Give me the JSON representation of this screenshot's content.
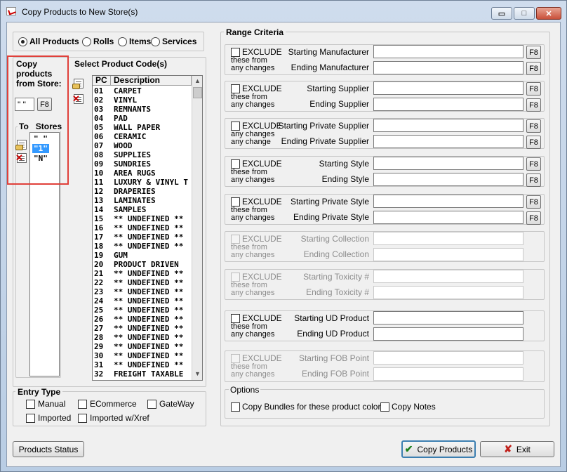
{
  "window": {
    "title": "Copy Products to New Store(s)",
    "controls": {
      "minimize": "▭",
      "maximize": "□",
      "close": "✕"
    }
  },
  "product_type": {
    "options": [
      "All Products",
      "Rolls",
      "Items",
      "Services"
    ],
    "selected": "All Products"
  },
  "copy_from": {
    "label": "Copy products from Store:",
    "value": "\" \"",
    "lookup_label": "F8"
  },
  "to_stores": {
    "label": "To   Stores",
    "items": [
      "\" \"",
      "\"1\"",
      "\"N\""
    ],
    "selected_index": 1
  },
  "product_codes": {
    "label": "Select Product Code(s)",
    "columns": [
      "PC",
      "Description"
    ],
    "rows": [
      [
        "01",
        "CARPET"
      ],
      [
        "02",
        "VINYL"
      ],
      [
        "03",
        "REMNANTS"
      ],
      [
        "04",
        "PAD"
      ],
      [
        "05",
        "WALL PAPER"
      ],
      [
        "06",
        "CERAMIC"
      ],
      [
        "07",
        "WOOD"
      ],
      [
        "08",
        "SUPPLIES"
      ],
      [
        "09",
        "SUNDRIES"
      ],
      [
        "10",
        "AREA RUGS"
      ],
      [
        "11",
        "LUXURY & VINYL T"
      ],
      [
        "12",
        "DRAPERIES"
      ],
      [
        "13",
        "LAMINATES"
      ],
      [
        "14",
        "SAMPLES"
      ],
      [
        "15",
        "** UNDEFINED **"
      ],
      [
        "16",
        "** UNDEFINED **"
      ],
      [
        "17",
        "** UNDEFINED **"
      ],
      [
        "18",
        "** UNDEFINED **"
      ],
      [
        "19",
        "GUM"
      ],
      [
        "20",
        "PRODUCT DRIVEN"
      ],
      [
        "21",
        "** UNDEFINED **"
      ],
      [
        "22",
        "** UNDEFINED **"
      ],
      [
        "23",
        "** UNDEFINED **"
      ],
      [
        "24",
        "** UNDEFINED **"
      ],
      [
        "25",
        "** UNDEFINED **"
      ],
      [
        "26",
        "** UNDEFINED **"
      ],
      [
        "27",
        "** UNDEFINED **"
      ],
      [
        "28",
        "** UNDEFINED **"
      ],
      [
        "29",
        "** UNDEFINED **"
      ],
      [
        "30",
        "** UNDEFINED **"
      ],
      [
        "31",
        "** UNDEFINED **"
      ],
      [
        "32",
        "FREIGHT TAXABLE"
      ]
    ]
  },
  "entry_type": {
    "label": "Entry Type",
    "options": [
      "Manual",
      "ECommerce",
      "GateWay",
      "Imported",
      "Imported w/Xref"
    ]
  },
  "range_criteria": {
    "label": "Range Criteria",
    "exclude_label": "EXCLUDE",
    "groups": [
      {
        "sub": [
          "these from",
          "any changes"
        ],
        "start": "Starting Manufacturer",
        "end": "Ending Manufacturer",
        "enabled": true,
        "f8": true
      },
      {
        "sub": [
          "these from",
          "any changes"
        ],
        "start": "Starting Supplier",
        "end": "Ending Supplier",
        "enabled": true,
        "f8": true
      },
      {
        "sub": [
          "any changes",
          "any change"
        ],
        "start": "Starting Private Supplier",
        "end": "Ending Private Supplier",
        "enabled": true,
        "f8": true
      },
      {
        "sub": [
          "these from",
          "any changes"
        ],
        "start": "Starting Style",
        "end": "Ending Style",
        "enabled": true,
        "f8": true
      },
      {
        "sub": [
          "these from",
          "any changes"
        ],
        "start": "Starting Private Style",
        "end": "Ending Private Style",
        "enabled": true,
        "f8": true
      },
      {
        "sub": [
          "these from",
          "any changes"
        ],
        "start": "Starting Collection",
        "end": "Ending Collection",
        "enabled": false,
        "f8": false
      },
      {
        "sub": [
          "these from",
          "any changes"
        ],
        "start": "Starting Toxicity #",
        "end": "Ending Toxicity #",
        "enabled": false,
        "f8": false
      },
      {
        "sub": [
          "these from",
          "any changes"
        ],
        "start": "Starting UD Product",
        "end": "Ending UD Product",
        "enabled": true,
        "f8": false
      },
      {
        "sub": [
          "these from",
          "any changes"
        ],
        "start": "Starting FOB Point",
        "end": "Ending FOB Point",
        "enabled": false,
        "f8": false
      }
    ]
  },
  "options": {
    "label": "Options",
    "copy_bundles": "Copy Bundles for these product colors",
    "copy_notes": "Copy Notes"
  },
  "buttons": {
    "products_status": "Products Status",
    "copy_products": "Copy Products",
    "exit": "Exit"
  }
}
